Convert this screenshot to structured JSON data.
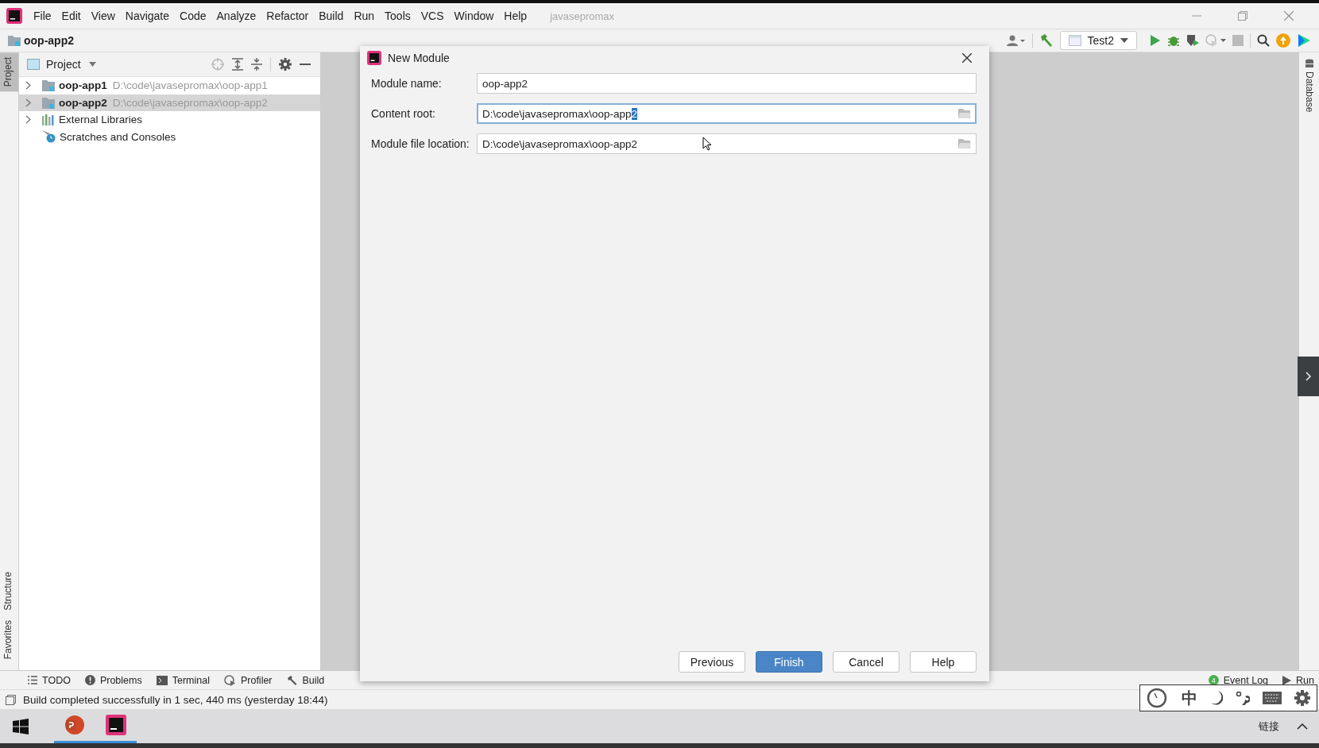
{
  "menu_bar": {
    "items": [
      {
        "label": "File"
      },
      {
        "label": "Edit"
      },
      {
        "label": "View"
      },
      {
        "label": "Navigate"
      },
      {
        "label": "Code"
      },
      {
        "label": "Analyze"
      },
      {
        "label": "Refactor"
      },
      {
        "label": "Build"
      },
      {
        "label": "Run"
      },
      {
        "label": "Tools"
      },
      {
        "label": "VCS"
      },
      {
        "label": "Window"
      },
      {
        "label": "Help"
      }
    ],
    "project_title": "javasepromax"
  },
  "nav_bar": {
    "breadcrumb": "oop-app2",
    "run_config": "Test2"
  },
  "left_stripe": [
    {
      "label": "Project",
      "selected": true
    },
    {
      "label": "Structure",
      "selected": false
    },
    {
      "label": "Favorites",
      "selected": false
    }
  ],
  "right_stripe": [
    {
      "label": "Database"
    }
  ],
  "project_panel": {
    "title": "Project",
    "tree": [
      {
        "kind": "module",
        "name": "oop-app1",
        "path": "D:\\code\\javasepromax\\oop-app1",
        "selected": false,
        "expandable": true
      },
      {
        "kind": "module",
        "name": "oop-app2",
        "path": "D:\\code\\javasepromax\\oop-app2",
        "selected": true,
        "expandable": true
      },
      {
        "kind": "libraries",
        "name": "External Libraries",
        "selected": false,
        "expandable": true
      },
      {
        "kind": "scratches",
        "name": "Scratches and Consoles",
        "selected": false,
        "expandable": false
      }
    ]
  },
  "dialog": {
    "title": "New Module",
    "fields": [
      {
        "label": "Module name:",
        "value": "oop-app2",
        "focused": false,
        "browse": false
      },
      {
        "label": "Content root:",
        "value": "D:\\code\\javasepromax\\oop-app",
        "selected_text": "2",
        "focused": true,
        "browse": true
      },
      {
        "label": "Module file location:",
        "value": "D:\\code\\javasepromax\\oop-app2",
        "focused": false,
        "browse": true
      }
    ],
    "buttons": [
      {
        "label": "Previous",
        "default": false
      },
      {
        "label": "Finish",
        "default": true
      },
      {
        "label": "Cancel",
        "default": false
      },
      {
        "label": "Help",
        "default": false
      }
    ]
  },
  "tool_tabs": [
    {
      "kind": "todo",
      "label": "TODO"
    },
    {
      "kind": "problems",
      "label": "Problems"
    },
    {
      "kind": "terminal",
      "label": "Terminal"
    },
    {
      "kind": "profiler",
      "label": "Profiler"
    },
    {
      "kind": "build",
      "label": "Build"
    }
  ],
  "right_tool_tabs": [
    {
      "kind": "eventlog",
      "label": "Event Log",
      "badge": "4"
    },
    {
      "kind": "run",
      "label": "Run"
    }
  ],
  "status_bar": {
    "message": "Build completed successfully in 1 sec, 440 ms (yesterday 18:44)"
  },
  "ime_bar": {
    "mode": "中"
  },
  "taskbar": {
    "tray_label": "链接"
  }
}
